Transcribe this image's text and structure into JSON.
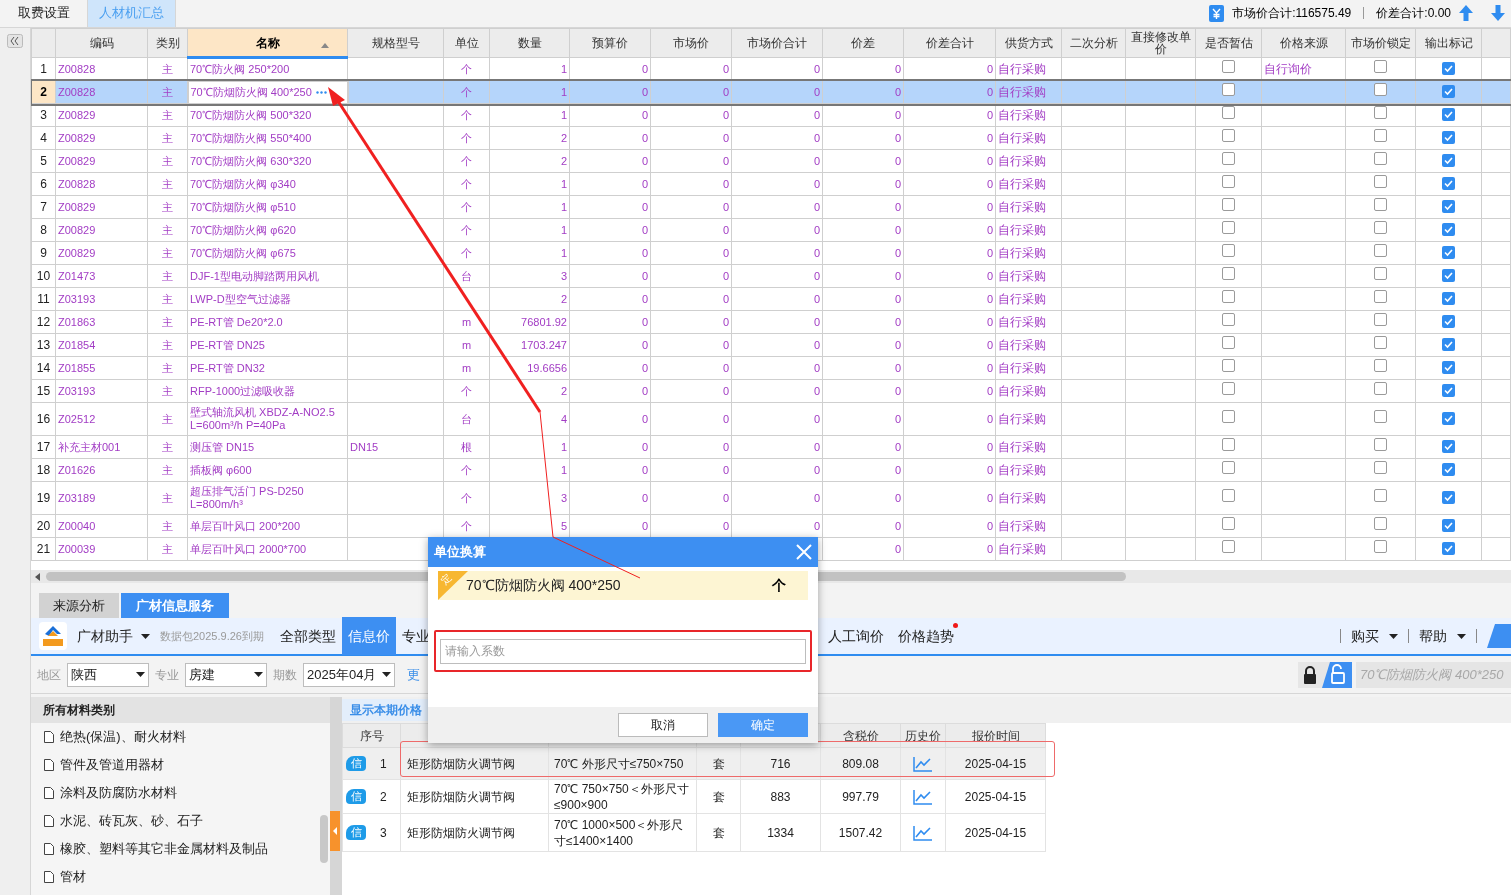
{
  "top_tabs": [
    {
      "label": "取费设置",
      "selected": false
    },
    {
      "label": "人材机汇总",
      "selected": true
    }
  ],
  "totals": {
    "market_total": "市场价合计:116575.49",
    "diff_total": "价差合计:0.00"
  },
  "table": {
    "columns": [
      {
        "label": "编码",
        "sorted": false
      },
      {
        "label": "类别",
        "sorted": false
      },
      {
        "label": "名称",
        "sorted": true
      },
      {
        "label": "规格型号",
        "sorted": false
      },
      {
        "label": "单位",
        "sorted": false
      },
      {
        "label": "数量",
        "sorted": false
      },
      {
        "label": "预算价",
        "sorted": false
      },
      {
        "label": "市场价",
        "sorted": false
      },
      {
        "label": "市场价合计",
        "sorted": false
      },
      {
        "label": "价差",
        "sorted": false
      },
      {
        "label": "价差合计",
        "sorted": false
      },
      {
        "label": "供货方式",
        "sorted": false
      },
      {
        "label": "二次分析",
        "sorted": false
      },
      {
        "label": "直接修改单价",
        "sorted": false
      },
      {
        "label": "是否暂估",
        "sorted": false
      },
      {
        "label": "价格来源",
        "sorted": false
      },
      {
        "label": "市场价锁定",
        "sorted": false
      },
      {
        "label": "输出标记",
        "sorted": false
      }
    ],
    "rows": [
      {
        "no": "1",
        "code": "Z00828",
        "type": "主",
        "name": "70℃防火阀  250*200",
        "unit": "个",
        "qty": "1",
        "prices": [
          "0",
          "0",
          "0",
          "0",
          "0"
        ],
        "supply": "自行采购",
        "source": "自行询价",
        "estimated": false,
        "locked": false,
        "output": true,
        "selected": false
      },
      {
        "no": "2",
        "code": "Z00828",
        "type": "主",
        "name": "70℃防烟防火阀 400*250",
        "unit": "个",
        "qty": "1",
        "prices": [
          "0",
          "0",
          "0",
          "0",
          "0"
        ],
        "supply": "自行采购",
        "estimated": false,
        "locked": false,
        "output": true,
        "selected": true
      },
      {
        "no": "3",
        "code": "Z00829",
        "type": "主",
        "name": "70℃防烟防火阀 500*320",
        "unit": "个",
        "qty": "1",
        "prices": [
          "0",
          "0",
          "0",
          "0",
          "0"
        ],
        "supply": "自行采购",
        "estimated": false,
        "locked": false,
        "output": true,
        "selected": false
      },
      {
        "no": "4",
        "code": "Z00829",
        "type": "主",
        "name": "70℃防烟防火阀 550*400",
        "unit": "个",
        "qty": "2",
        "prices": [
          "0",
          "0",
          "0",
          "0",
          "0"
        ],
        "supply": "自行采购",
        "estimated": false,
        "locked": false,
        "output": true,
        "selected": false
      },
      {
        "no": "5",
        "code": "Z00829",
        "type": "主",
        "name": "70℃防烟防火阀 630*320",
        "unit": "个",
        "qty": "2",
        "prices": [
          "0",
          "0",
          "0",
          "0",
          "0"
        ],
        "supply": "自行采购",
        "estimated": false,
        "locked": false,
        "output": true,
        "selected": false
      },
      {
        "no": "6",
        "code": "Z00828",
        "type": "主",
        "name": "70℃防烟防火阀 φ340",
        "unit": "个",
        "qty": "1",
        "prices": [
          "0",
          "0",
          "0",
          "0",
          "0"
        ],
        "supply": "自行采购",
        "estimated": false,
        "locked": false,
        "output": true,
        "selected": false
      },
      {
        "no": "7",
        "code": "Z00829",
        "type": "主",
        "name": "70℃防烟防火阀 φ510",
        "unit": "个",
        "qty": "1",
        "prices": [
          "0",
          "0",
          "0",
          "0",
          "0"
        ],
        "supply": "自行采购",
        "estimated": false,
        "locked": false,
        "output": true,
        "selected": false
      },
      {
        "no": "8",
        "code": "Z00829",
        "type": "主",
        "name": "70℃防烟防火阀 φ620",
        "unit": "个",
        "qty": "1",
        "prices": [
          "0",
          "0",
          "0",
          "0",
          "0"
        ],
        "supply": "自行采购",
        "estimated": false,
        "locked": false,
        "output": true,
        "selected": false
      },
      {
        "no": "9",
        "code": "Z00829",
        "type": "主",
        "name": "70℃防烟防火阀 φ675",
        "unit": "个",
        "qty": "1",
        "prices": [
          "0",
          "0",
          "0",
          "0",
          "0"
        ],
        "supply": "自行采购",
        "estimated": false,
        "locked": false,
        "output": true,
        "selected": false
      },
      {
        "no": "10",
        "code": "Z01473",
        "type": "主",
        "name": "DJF-1型电动脚踏两用风机",
        "unit": "台",
        "qty": "3",
        "prices": [
          "0",
          "0",
          "0",
          "0",
          "0"
        ],
        "supply": "自行采购",
        "estimated": false,
        "locked": false,
        "output": true,
        "selected": false
      },
      {
        "no": "11",
        "code": "Z03193",
        "type": "主",
        "name": "LWP-D型空气过滤器",
        "qty": "2",
        "prices": [
          "0",
          "0",
          "0",
          "0",
          "0"
        ],
        "supply": "自行采购",
        "estimated": false,
        "locked": false,
        "output": true,
        "selected": false
      },
      {
        "no": "12",
        "code": "Z01863",
        "type": "主",
        "name": "PE-RT管 De20*2.0",
        "unit": "m",
        "qty": "76801.92",
        "prices": [
          "0",
          "0",
          "0",
          "0",
          "0"
        ],
        "supply": "自行采购",
        "estimated": false,
        "locked": false,
        "output": true,
        "selected": false
      },
      {
        "no": "13",
        "code": "Z01854",
        "type": "主",
        "name": "PE-RT管 DN25",
        "unit": "m",
        "qty": "1703.247",
        "prices": [
          "0",
          "0",
          "0",
          "0",
          "0"
        ],
        "supply": "自行采购",
        "estimated": false,
        "locked": false,
        "output": true,
        "selected": false
      },
      {
        "no": "14",
        "code": "Z01855",
        "type": "主",
        "name": "PE-RT管 DN32",
        "unit": "m",
        "qty": "19.6656",
        "prices": [
          "0",
          "0",
          "0",
          "0",
          "0"
        ],
        "supply": "自行采购",
        "estimated": false,
        "locked": false,
        "output": true,
        "selected": false
      },
      {
        "no": "15",
        "code": "Z03193",
        "type": "主",
        "name": "RFP-1000过滤吸收器",
        "unit": "个",
        "qty": "2",
        "prices": [
          "0",
          "0",
          "0",
          "0",
          "0"
        ],
        "supply": "自行采购",
        "estimated": false,
        "locked": false,
        "output": true,
        "selected": false
      },
      {
        "no": "16",
        "code": "Z02512",
        "type": "主",
        "name": "壁式轴流风机 XBDZ-A-NO2.5\nL=600m³/h P=40Pa",
        "unit": "台",
        "qty": "4",
        "prices": [
          "0",
          "0",
          "0",
          "0",
          "0"
        ],
        "supply": "自行采购",
        "estimated": false,
        "locked": false,
        "output": true,
        "selected": false
      },
      {
        "no": "17",
        "code": "补充主材001",
        "type": "主",
        "name": "测压管 DN15",
        "spec": "DN15",
        "unit": "根",
        "qty": "1",
        "prices": [
          "0",
          "0",
          "0",
          "0",
          "0"
        ],
        "supply": "自行采购",
        "estimated": false,
        "locked": false,
        "output": true,
        "selected": false
      },
      {
        "no": "18",
        "code": "Z01626",
        "type": "主",
        "name": "插板阀 φ600",
        "unit": "个",
        "qty": "1",
        "prices": [
          "0",
          "0",
          "0",
          "0",
          "0"
        ],
        "supply": "自行采购",
        "estimated": false,
        "locked": false,
        "output": true,
        "selected": false
      },
      {
        "no": "19",
        "code": "Z03189",
        "type": "主",
        "name": "超压排气活门 PS-D250\nL=800m/h³",
        "unit": "个",
        "qty": "3",
        "prices": [
          "0",
          "0",
          "0",
          "0",
          "0"
        ],
        "supply": "自行采购",
        "estimated": false,
        "locked": false,
        "output": true,
        "selected": false
      },
      {
        "no": "20",
        "code": "Z00040",
        "type": "主",
        "name": "单层百叶风口 200*200",
        "unit": "个",
        "qty": "5",
        "prices": [
          "0",
          "0",
          "0",
          "0",
          "0"
        ],
        "supply": "自行采购",
        "estimated": false,
        "locked": false,
        "output": true,
        "selected": false
      },
      {
        "no": "21",
        "code": "Z00039",
        "type": "主",
        "name": "单层百叶风口 2000*700",
        "prices": [
          "0",
          "0"
        ],
        "supply": "自行采购",
        "estimated": false,
        "locked": false,
        "output": true,
        "selected": false
      }
    ]
  },
  "bottom_tabs": [
    {
      "label": "来源分析",
      "selected": false
    },
    {
      "label": "广材信息服务",
      "selected": true
    }
  ],
  "toolbar": {
    "brand": "广材助手",
    "package": "数据包2025.9.26到期",
    "menu": [
      {
        "label": "全部类型",
        "selected": false
      },
      {
        "label": "信息价",
        "selected": true
      },
      {
        "label": "专业",
        "selected": false
      }
    ],
    "menu_right": [
      {
        "label": "人工询价",
        "badge": false
      },
      {
        "label": "价格趋势",
        "badge": true
      }
    ],
    "right_menus": [
      "购买",
      "帮助"
    ]
  },
  "filters": {
    "fields": [
      {
        "label": "地区",
        "value": "陕西"
      },
      {
        "label": "专业",
        "value": "房建"
      },
      {
        "label": "期数",
        "value": "2025年04月"
      }
    ],
    "more_link": "更",
    "locked": false,
    "search": {
      "placeholder": "70℃防烟防火阀 400*250"
    }
  },
  "categories": {
    "title": "所有材料类别",
    "items": [
      "绝热(保温)、耐火材料",
      "管件及管道用器材",
      "涂料及防腐防水材料",
      "水泥、砖瓦灰、砂、石子",
      "橡胶、塑料等其它非金属材料及制品",
      "管材"
    ]
  },
  "results": {
    "show_current_link": "显示本期价格",
    "columns": [
      "序号",
      null,
      null,
      null,
      null,
      "含税价",
      "历史价",
      "报价时间"
    ],
    "rows": [
      {
        "badge": "信",
        "no": "1",
        "name": "矩形防烟防火调节阀",
        "spec": "70℃ 外形尺寸≤750×750",
        "unit": "套",
        "price": "716",
        "tax_price": "809.08",
        "date": "2025-04-15",
        "selected": true
      },
      {
        "badge": "信",
        "no": "2",
        "name": "矩形防烟防火调节阀",
        "spec": "70℃ 750×750＜外形尺寸≤900×900",
        "unit": "套",
        "price": "883",
        "tax_price": "997.79",
        "date": "2025-04-15",
        "selected": false
      },
      {
        "badge": "信",
        "no": "3",
        "name": "矩形防烟防火调节阀",
        "spec": "70℃ 1000×500＜外形尺寸≤1400×1400",
        "unit": "套",
        "price": "1334",
        "tax_price": "1507.42",
        "date": "2025-04-15",
        "selected": false
      }
    ]
  },
  "dialog": {
    "title": "单位换算",
    "item": {
      "badge": "定",
      "name": "70℃防烟防火阀 400*250",
      "unit": "个"
    },
    "input": {
      "placeholder": "请输入系数"
    },
    "buttons": [
      "取消",
      "确定"
    ]
  }
}
